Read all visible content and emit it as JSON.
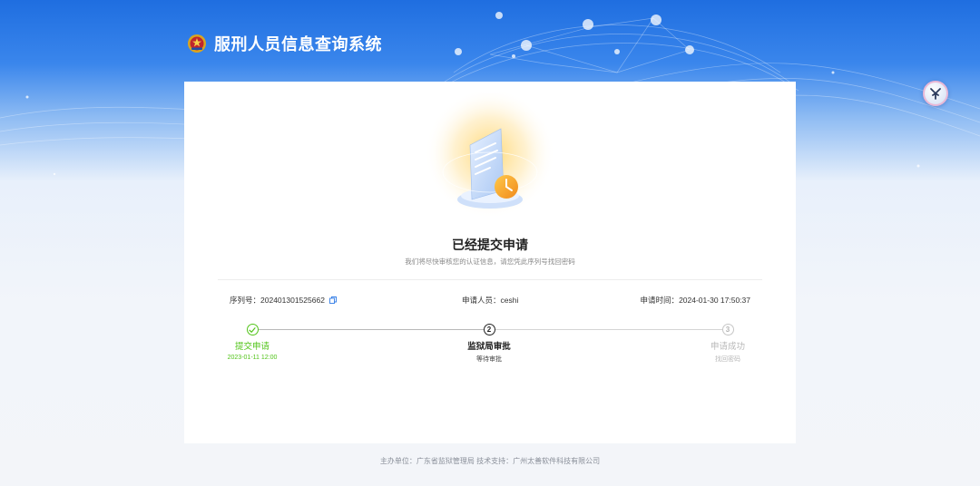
{
  "header": {
    "title": "服刑人员信息查询系统",
    "emblem_icon": "police-emblem-icon"
  },
  "floating_button": {
    "icon": "assistant-icon"
  },
  "result": {
    "title": "已经提交申请",
    "subtitle": "我们将尽快审核您的认证信息，请您凭此序列号找回密码"
  },
  "info": {
    "serial_label": "序列号：",
    "serial_value": "202401301525662",
    "applicant_label": "申请人员：",
    "applicant_value": "ceshi",
    "time_label": "申请时间：",
    "time_value": "2024-01-30 17:50:37"
  },
  "steps": [
    {
      "label": "提交申请",
      "desc": "2023-01-11 12:00",
      "number": "",
      "status": "done"
    },
    {
      "label": "监狱局审批",
      "desc": "等待审批",
      "number": "2",
      "status": "active"
    },
    {
      "label": "申请成功",
      "desc": "找回密码",
      "number": "3",
      "status": "wait"
    }
  ],
  "footer": "主办单位：广东省监狱管理局 技术支持：广州太善软件科技有限公司",
  "colors": {
    "brand_blue": "#2f7be6",
    "success": "#52c41a",
    "accent_orange": "#f5a623"
  }
}
